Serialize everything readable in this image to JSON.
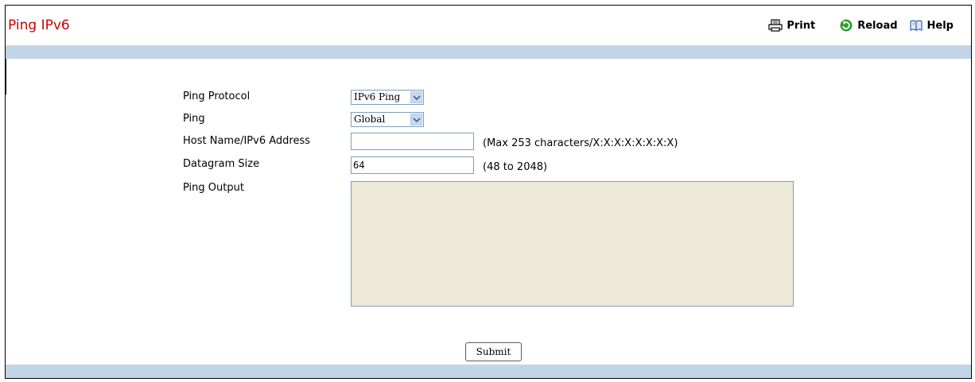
{
  "header": {
    "title": "Ping IPv6",
    "toolbar": {
      "print_label": "Print",
      "reload_label": "Reload",
      "help_label": "Help"
    }
  },
  "form": {
    "ping_protocol": {
      "label": "Ping Protocol",
      "selected": "IPv6 Ping"
    },
    "ping": {
      "label": "Ping",
      "selected": "Global"
    },
    "host": {
      "label": "Host Name/IPv6 Address",
      "value": "",
      "hint": "(Max 253 characters/X:X:X:X:X:X:X:X)"
    },
    "datagram_size": {
      "label": "Datagram Size",
      "value": "64",
      "hint": "(48 to 2048)"
    },
    "ping_output": {
      "label": "Ping Output",
      "value": ""
    },
    "submit_label": "Submit"
  },
  "icons": {
    "print": "printer-icon",
    "reload": "reload-icon",
    "help": "help-book-icon"
  },
  "colors": {
    "title": "#cc0000",
    "band": "#c2d5e6",
    "output_bg": "#ece9d8",
    "reload_icon": "#2e9e2e",
    "help_icon": "#3a62b8"
  }
}
